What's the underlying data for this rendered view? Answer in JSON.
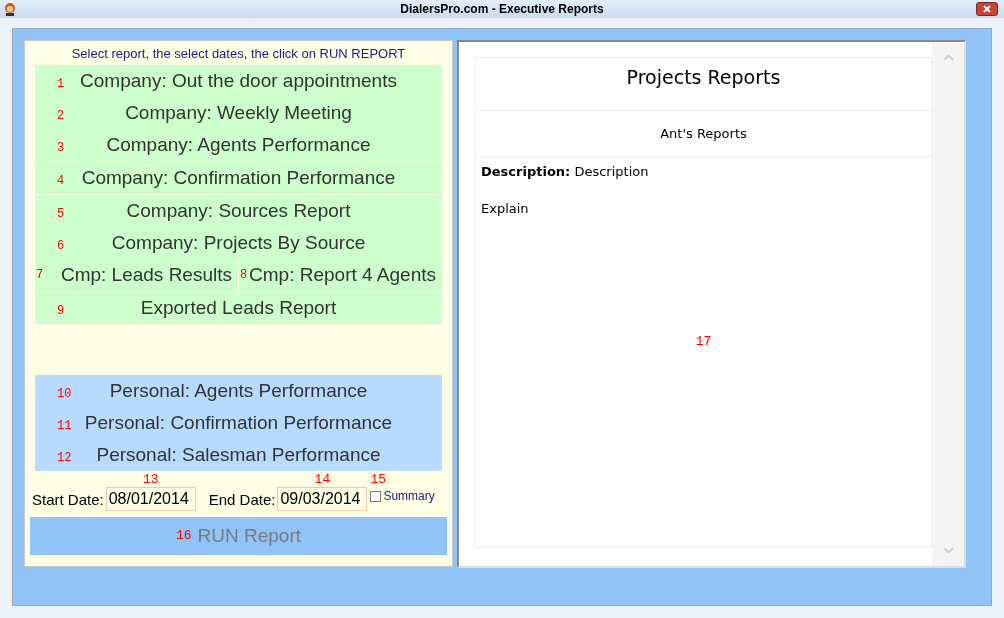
{
  "window": {
    "title": "DialersPro.com - Executive Reports"
  },
  "left_panel": {
    "instruction": "Select report, the select dates, the click on RUN REPORT",
    "groups": [
      {
        "color": "#ccffcc",
        "blocks": [
          [
            [
              {
                "marker": "1",
                "label": "Company: Out the door appointments"
              }
            ],
            [
              {
                "marker": "2",
                "label": "Company: Weekly Meeting"
              }
            ],
            [
              {
                "marker": "3",
                "label": "Company: Agents Performance"
              }
            ]
          ],
          [
            [
              {
                "marker": "4",
                "label": "Company: Confirmation Performance"
              }
            ]
          ],
          [
            [
              {
                "marker": "5",
                "label": "Company: Sources Report"
              }
            ],
            [
              {
                "marker": "6",
                "label": "Company: Projects By Source"
              }
            ],
            [
              {
                "marker": "7",
                "label": "Cmp: Leads Results"
              },
              {
                "marker": "8",
                "label": "Cmp: Report 4 Agents"
              }
            ]
          ],
          [
            [
              {
                "marker": "9",
                "label": "Exported Leads Report"
              }
            ]
          ]
        ]
      },
      {
        "color": "#b7dbff",
        "blocks": [
          [
            [
              {
                "marker": "10",
                "label": "Personal: Agents Performance"
              }
            ],
            [
              {
                "marker": "11",
                "label": "Personal: Confirmation Performance"
              }
            ],
            [
              {
                "marker": "12",
                "label": "Personal: Salesman Performance"
              }
            ]
          ]
        ]
      }
    ],
    "start_date": {
      "label": "Start Date:",
      "marker": "13",
      "value": "08/01/2014"
    },
    "end_date": {
      "label": "End Date:",
      "marker": "14",
      "value": "09/03/2014"
    },
    "summary": {
      "label": "Summary",
      "marker": "15",
      "checked": false
    },
    "run_button": {
      "marker": "16",
      "label": "RUN Report"
    }
  },
  "right_panel": {
    "title": "Projects Reports",
    "subtitle": "Ant's Reports",
    "description_label": "Description:",
    "description": "Description",
    "explain": "Explain",
    "marker": "17"
  }
}
